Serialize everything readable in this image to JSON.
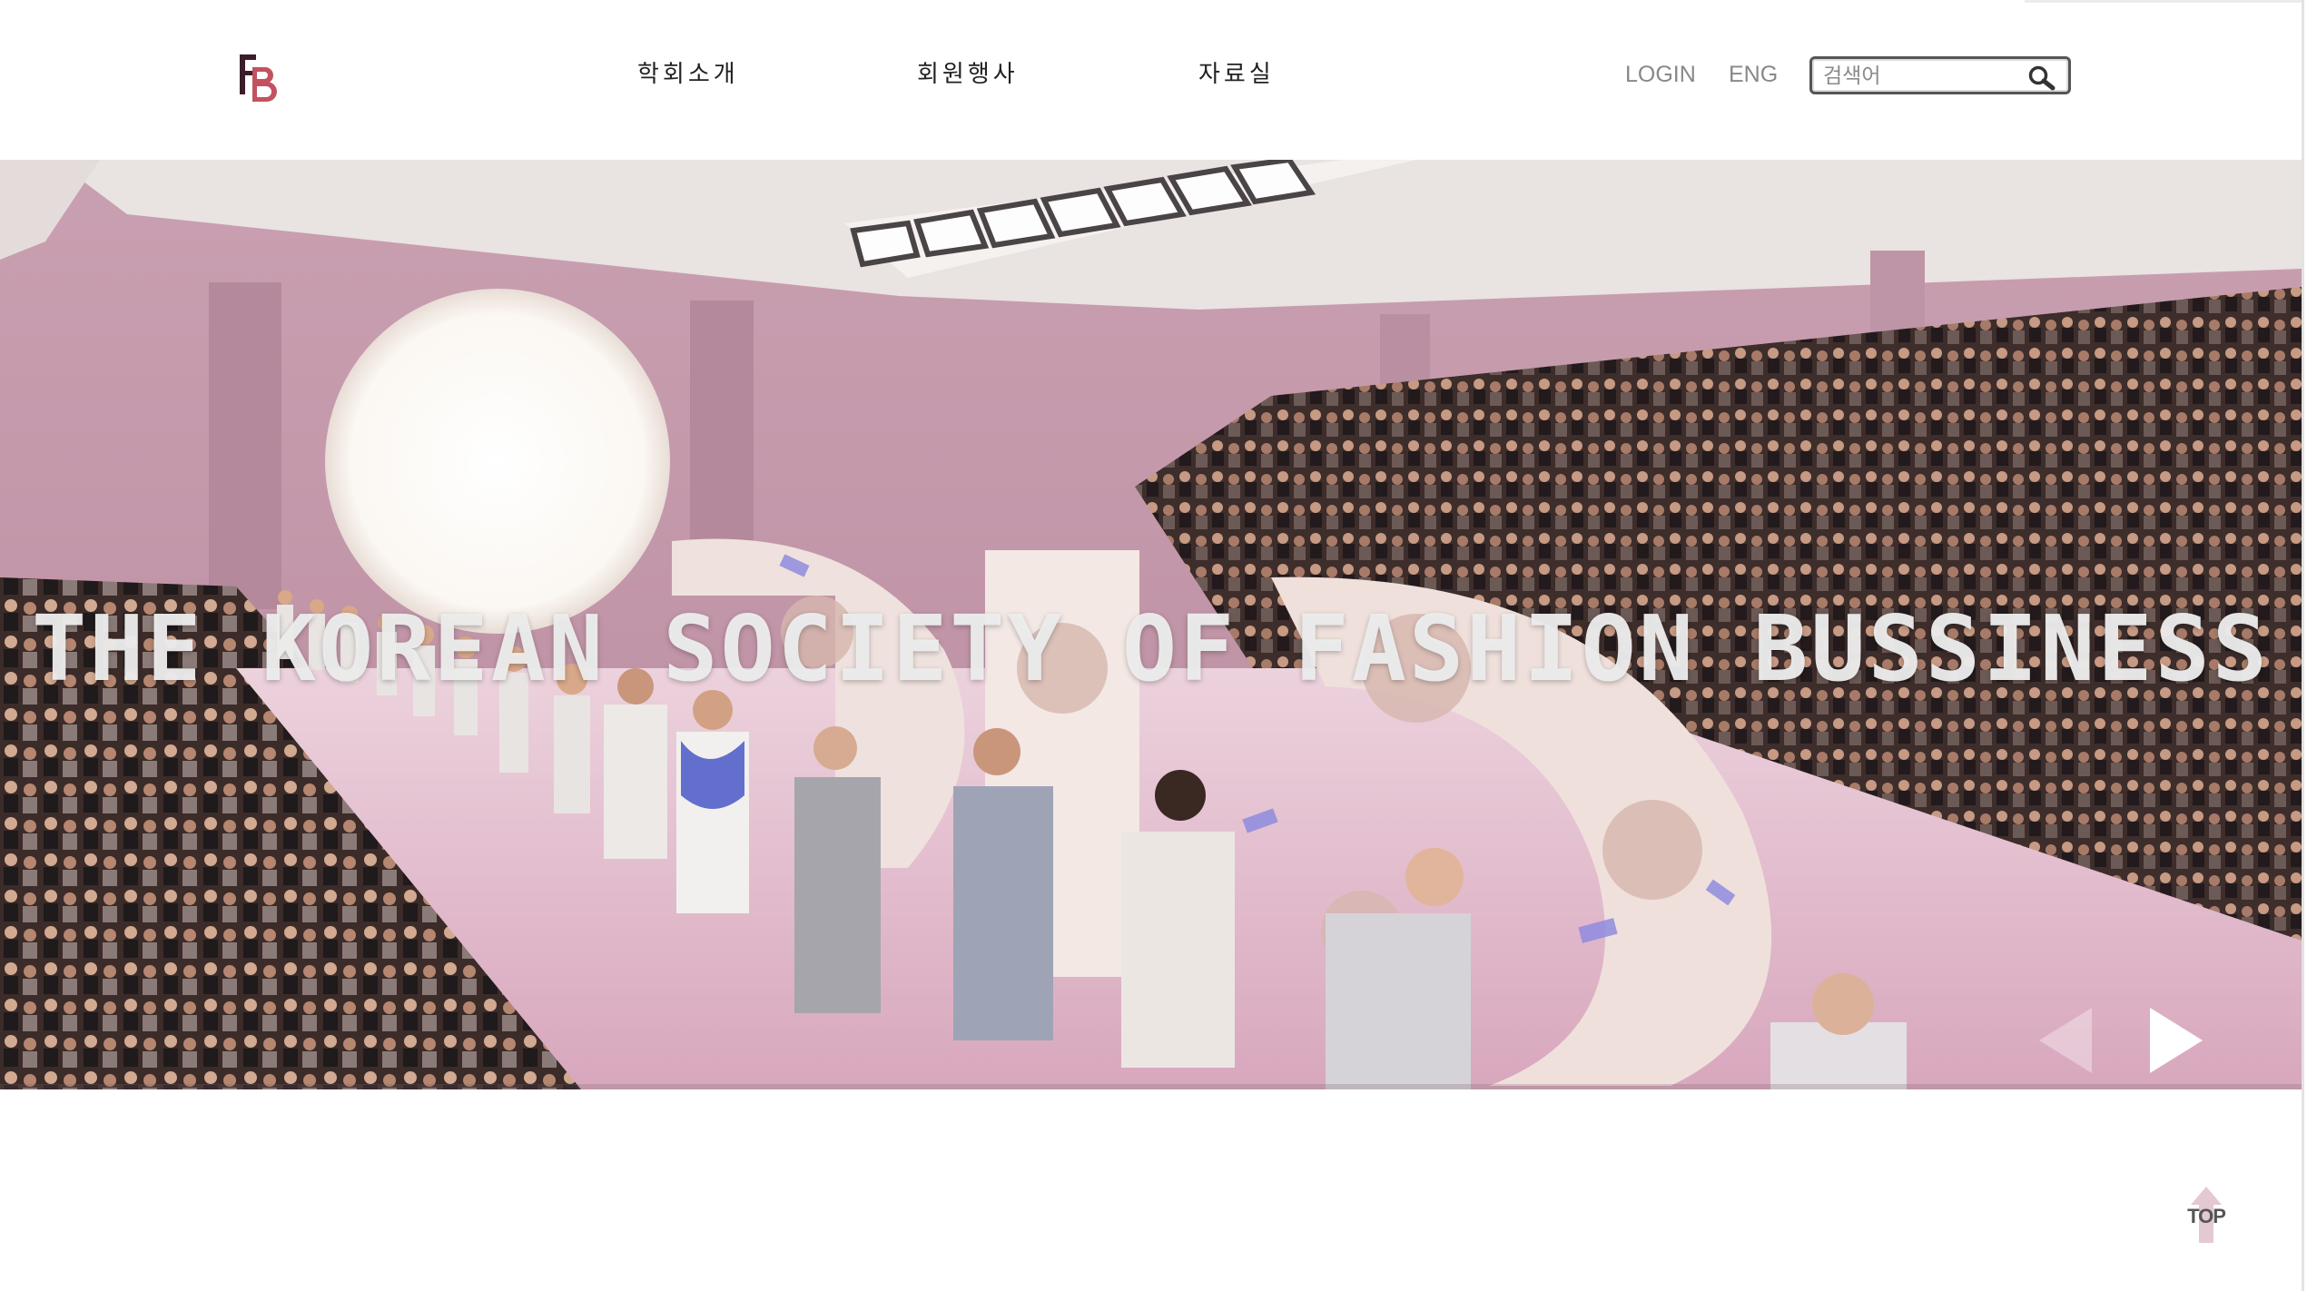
{
  "header": {
    "logo_text": "FB",
    "nav": [
      {
        "label": "학회소개"
      },
      {
        "label": "회원행사"
      },
      {
        "label": "자료실"
      }
    ],
    "login_label": "LOGIN",
    "lang_label": "ENG",
    "search": {
      "placeholder": "검색어",
      "value": ""
    }
  },
  "hero": {
    "title": "THE KOREAN SOCIETY OF FASHION BUSSINESS",
    "image_description": "fashion runway show with pink set and audience",
    "prev_icon": "triangle-left-icon",
    "next_icon": "triangle-right-icon"
  },
  "top_button": {
    "label": "TOP",
    "icon": "arrow-up-icon"
  },
  "colors": {
    "logo_dark": "#3a1f2b",
    "logo_accent": "#c2525f",
    "nav_text": "#222222",
    "util_text": "#888888",
    "hero_pink": "#c9a3b3",
    "runway_pink": "#e8c4d3"
  }
}
